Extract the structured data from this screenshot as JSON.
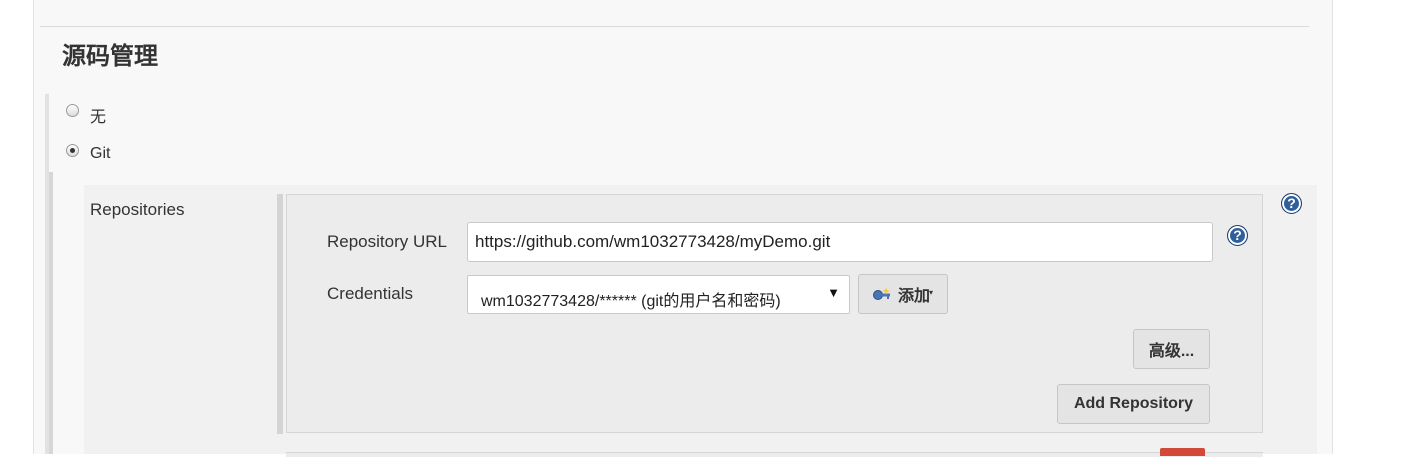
{
  "section": {
    "title": "源码管理"
  },
  "scm_options": [
    {
      "label": "无",
      "selected": false
    },
    {
      "label": "Git",
      "selected": true
    }
  ],
  "git": {
    "repositories_label": "Repositories",
    "repository_url": {
      "label": "Repository URL",
      "value": "https://github.com/wm1032773428/myDemo.git"
    },
    "credentials": {
      "label": "Credentials",
      "selected": "wm1032773428/****** (git的用户名和密码)",
      "add_label": "添加",
      "add_icon": "key-icon"
    },
    "advanced_label": "高级...",
    "add_repository_label": "Add Repository"
  },
  "help_icon": "?",
  "colors": {
    "help": "#2f5f9c",
    "delete": "#d24939",
    "panel": "#f8f8f8"
  }
}
